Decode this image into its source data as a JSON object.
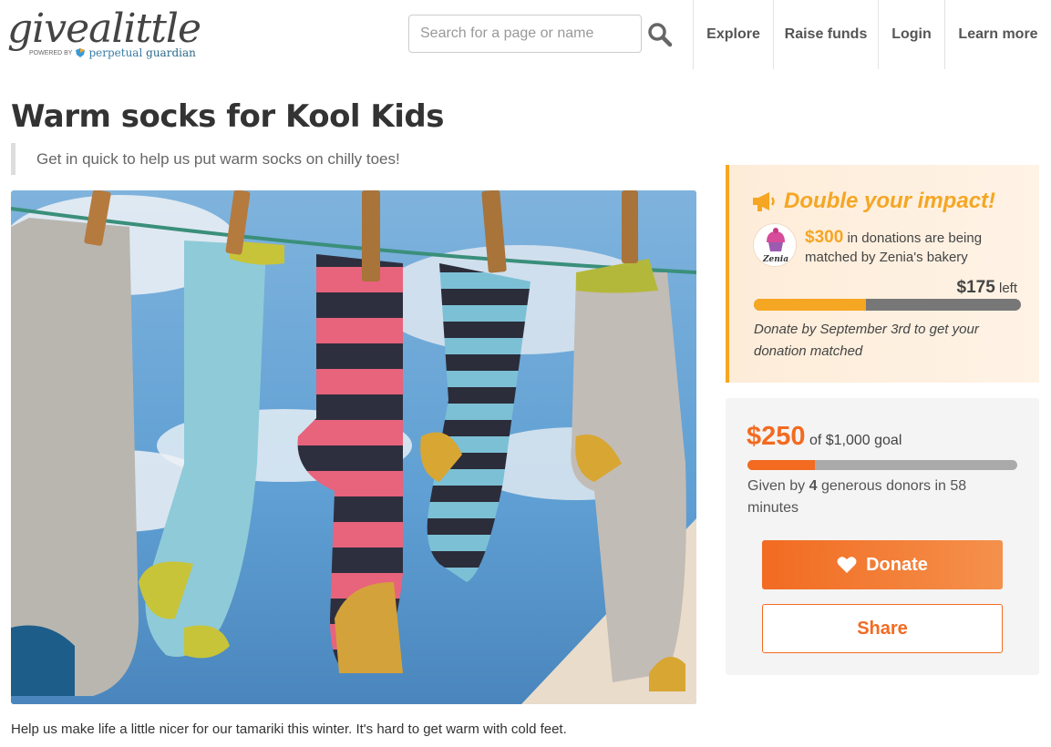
{
  "header": {
    "logo_text": "givealittle",
    "logo_powered": "POWERED BY",
    "logo_partner_a": "perpetual",
    "logo_partner_b": "guardian",
    "search_placeholder": "Search for a page or name",
    "nav": [
      "Explore",
      "Raise funds",
      "Login",
      "Learn more"
    ]
  },
  "page": {
    "title": "Warm socks for Kool Kids",
    "tagline": "Get in quick to help us put warm socks on chilly toes!",
    "description": "Help us make life a little nicer for our tamariki this winter. It's hard to get warm with cold feet."
  },
  "match": {
    "heading": "Double your impact!",
    "sponsor_logo_text": "Zenia",
    "amount": "$300",
    "text": " in donations are being matched by Zenia's bakery",
    "left_amount": "$175",
    "left_label": " left",
    "progress": 0.42,
    "note": "Donate by September 3rd to get your donation matched",
    "accent_color": "#f5a623"
  },
  "goal": {
    "raised": "$250",
    "goal_text": " of $1,000 goal",
    "progress": 0.25,
    "given_prefix": "Given by ",
    "donors": "4",
    "given_suffix": " generous donors in 58 minutes",
    "donate_label": "Donate",
    "share_label": "Share",
    "accent_color": "#f26b21"
  }
}
